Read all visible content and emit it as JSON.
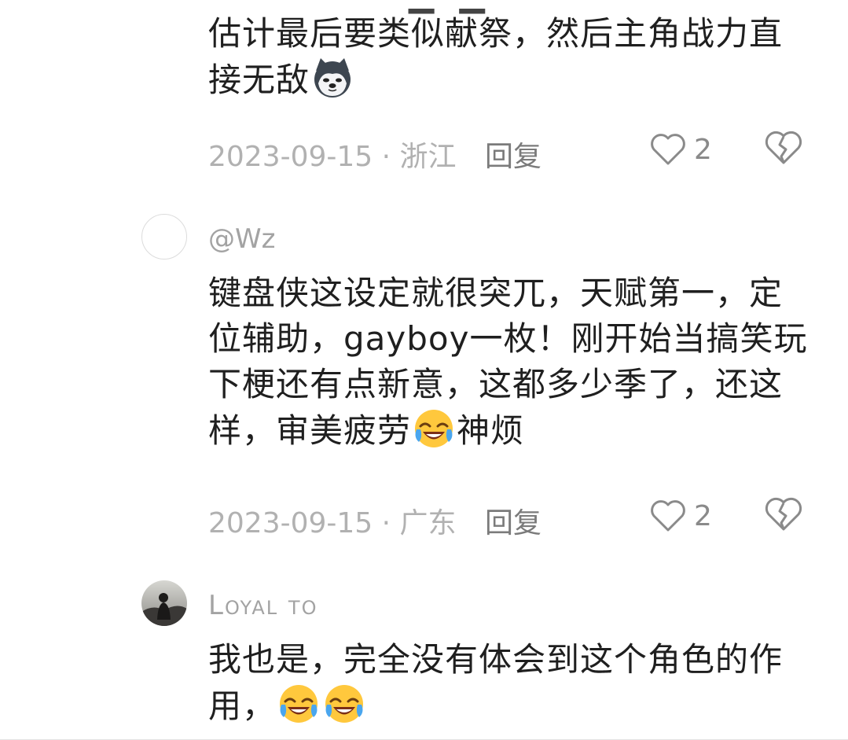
{
  "comments": [
    {
      "username": "",
      "text_lines": [
        "估计最后要类似献祭，然后主角战力直",
        "接无敌"
      ],
      "emoji": "husky-dog-emoji",
      "date": "2023-09-15",
      "location": "浙江",
      "meta_text": "2023-09-15 · 浙江",
      "reply_label": "回复",
      "likes": "2"
    },
    {
      "username": "@Wz",
      "text_lines": [
        "键盘侠这设定就很突兀，天赋第一，定",
        "位辅助，gayboy一枚！刚开始当搞笑玩",
        "下梗还有点新意，这都多少季了，还这",
        "样，审美疲劳",
        "神烦"
      ],
      "emoji": "laugh-cry-emoji",
      "date": "2023-09-15",
      "location": "广东",
      "meta_text": "2023-09-15 · 广东",
      "reply_label": "回复",
      "likes": "2"
    },
    {
      "username": "Loyal to",
      "text_lines": [
        "我也是，完全没有体会到这个角色的作",
        "用，"
      ],
      "emoji": "laugh-cry-emoji"
    }
  ],
  "icons": {
    "like": "heart-outline-icon",
    "dislike": "broken-heart-icon"
  },
  "colors": {
    "text": "#1f1f1f",
    "meta": "#b1b1b1",
    "reply": "#7b7b7b",
    "icon": "#8a8a8a"
  }
}
